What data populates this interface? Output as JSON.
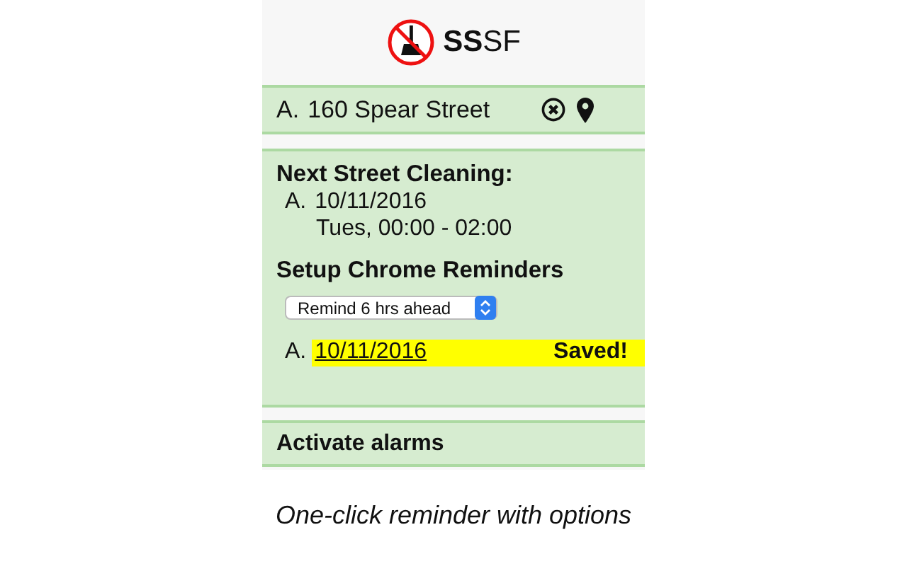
{
  "header": {
    "title_bold": "SS",
    "title_rest": "SF"
  },
  "address": {
    "letter": "A.",
    "street": "160 Spear Street"
  },
  "cleaning": {
    "heading": "Next Street Cleaning:",
    "letter": "A.",
    "date": "10/11/2016",
    "time": "Tues, 00:00 - 02:00"
  },
  "reminders": {
    "heading": "Setup Chrome Reminders",
    "select_value": "Remind 6 hrs ahead",
    "letter": "A.",
    "date_link": "10/11/2016",
    "status": "Saved!"
  },
  "alarms": {
    "label": "Activate alarms"
  },
  "caption": "One-click reminder with options"
}
